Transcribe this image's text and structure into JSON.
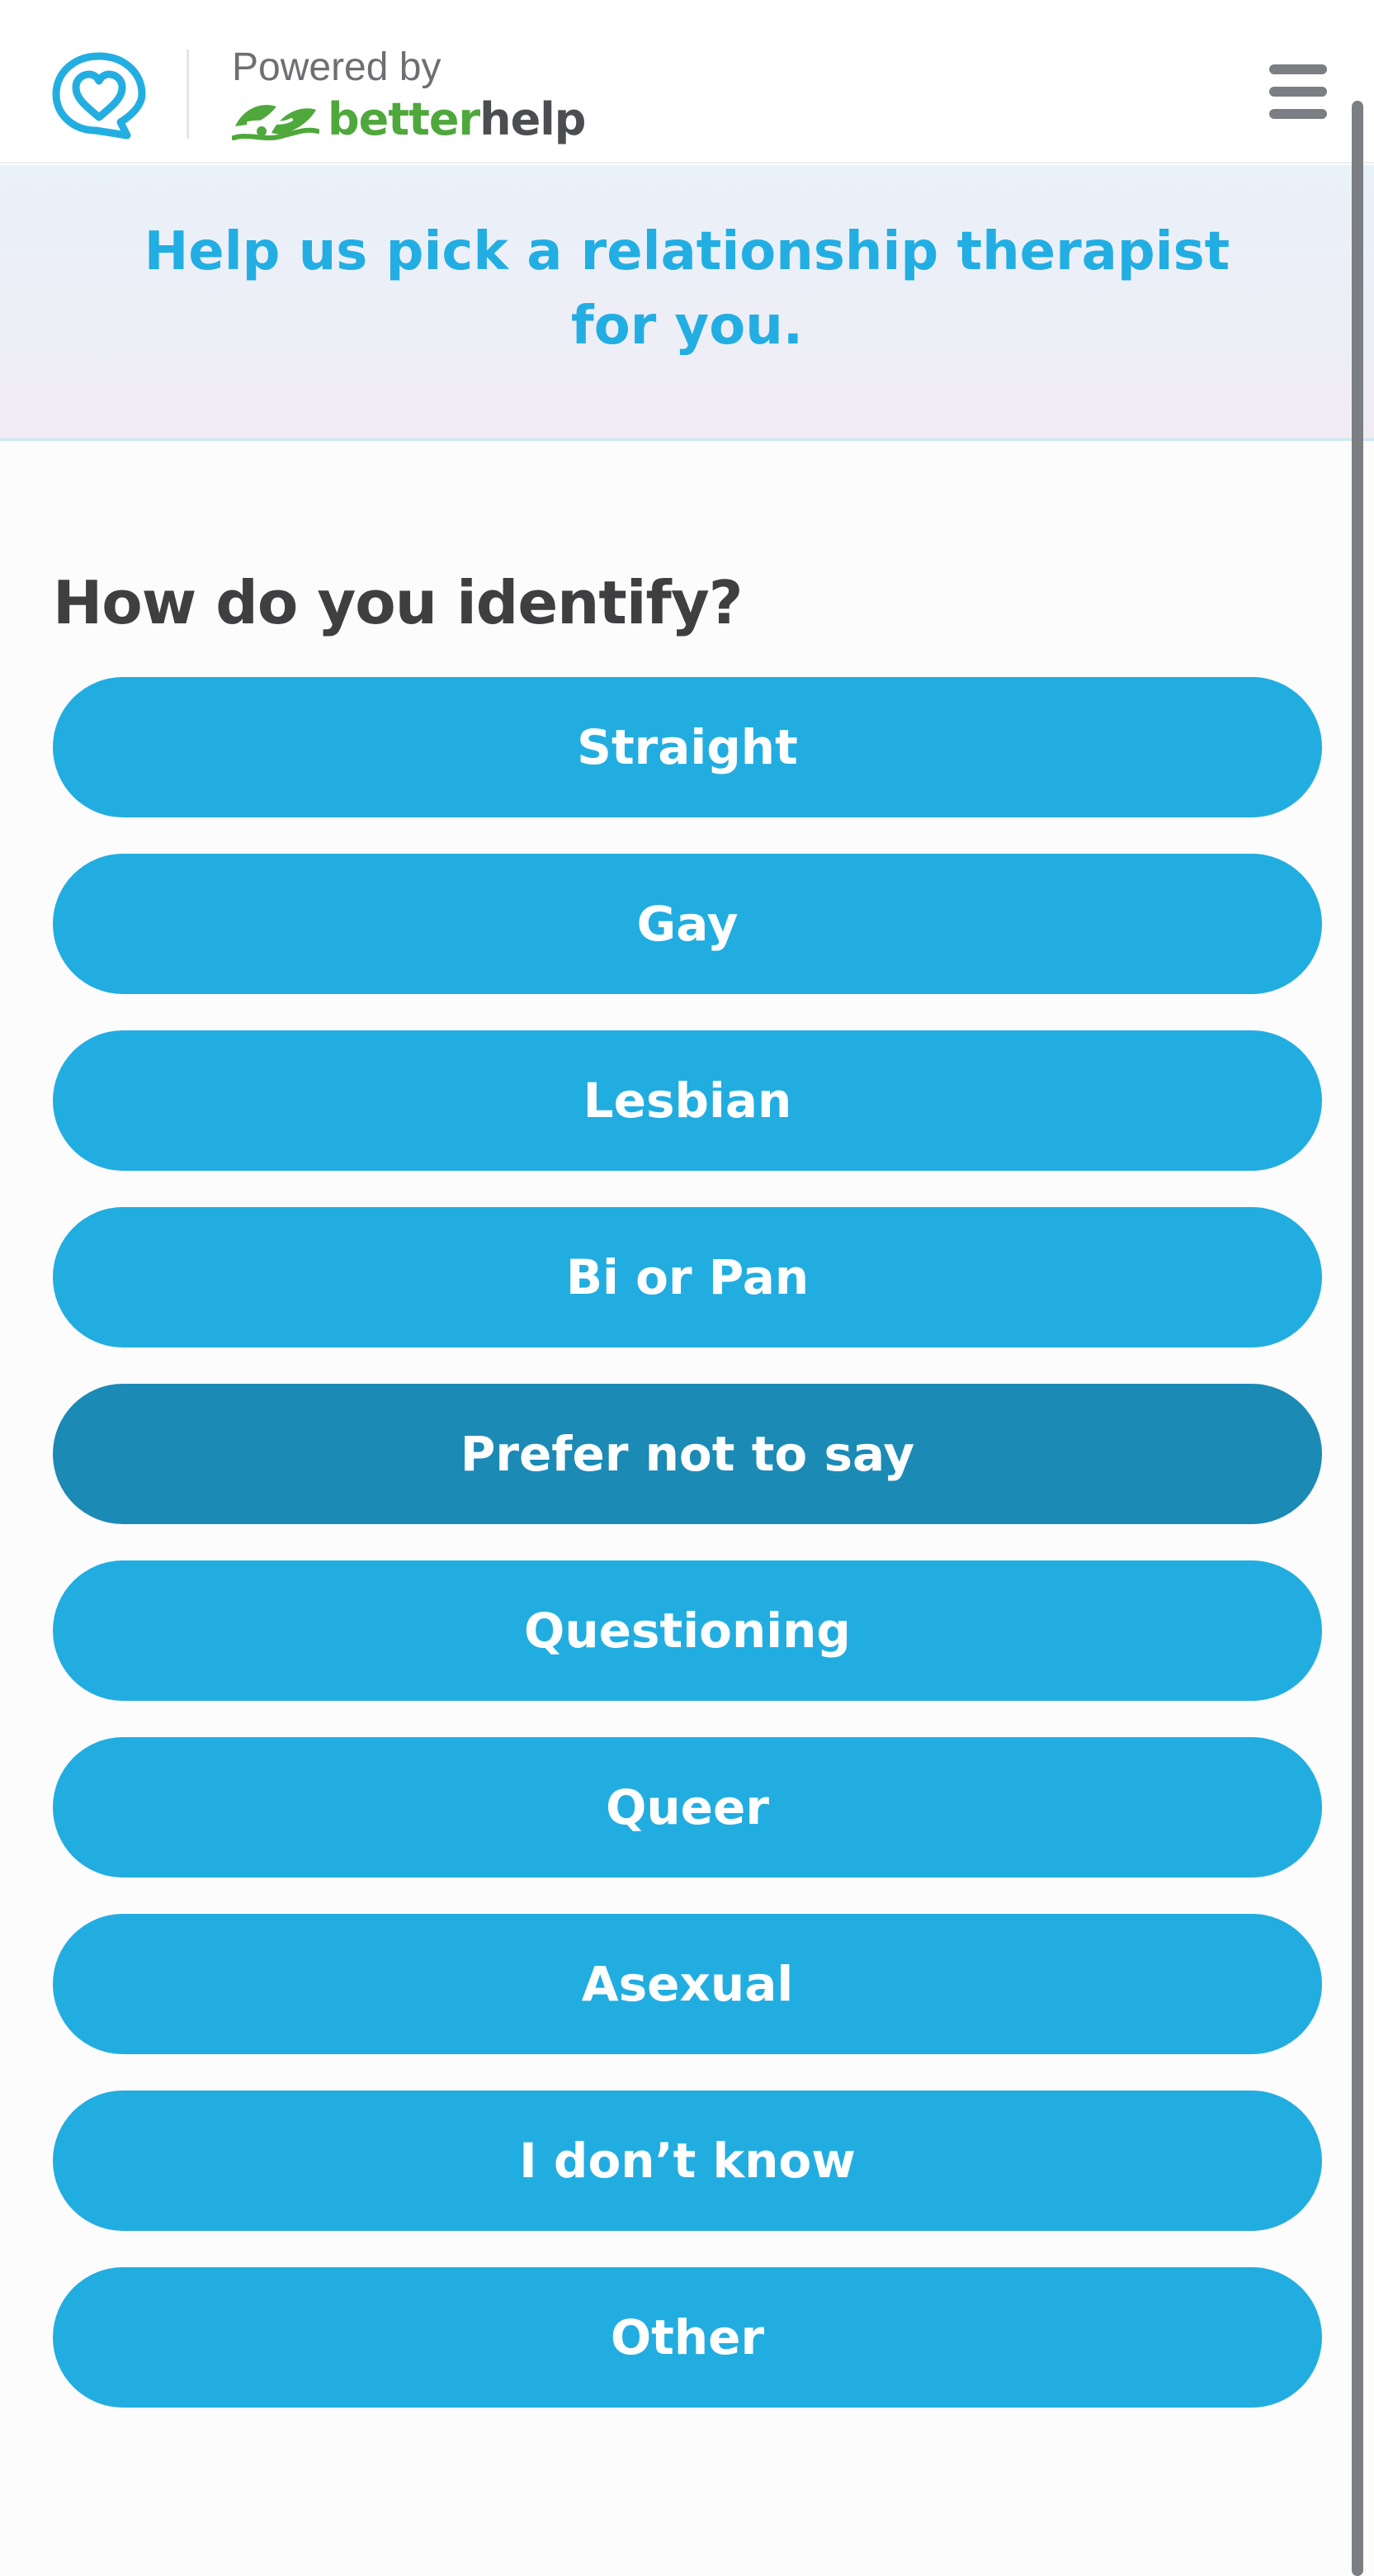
{
  "header": {
    "logo_icon": "heart-chat-bubble-icon",
    "powered_by": "Powered by",
    "brand_better": "better",
    "brand_help": "help",
    "brand_leaf_icon": "betterhelp-leaf-icon",
    "menu_icon": "hamburger-menu-icon"
  },
  "banner": {
    "title": "Help us pick a relationship therapist for you."
  },
  "question": {
    "label": "How do you identify?",
    "options": [
      "Straight",
      "Gay",
      "Lesbian",
      "Bi or Pan",
      "Prefer not to say",
      "Questioning",
      "Queer",
      "Asexual",
      "I don’t know",
      "Other"
    ],
    "selected": "Prefer not to say"
  },
  "colors": {
    "accent": "#22ade1",
    "accent_active": "#1b8ab5",
    "title": "#22aee2",
    "text_dark": "#3f3f41",
    "brand_green": "#4fa83b",
    "brand_gray": "#4b4d50"
  }
}
